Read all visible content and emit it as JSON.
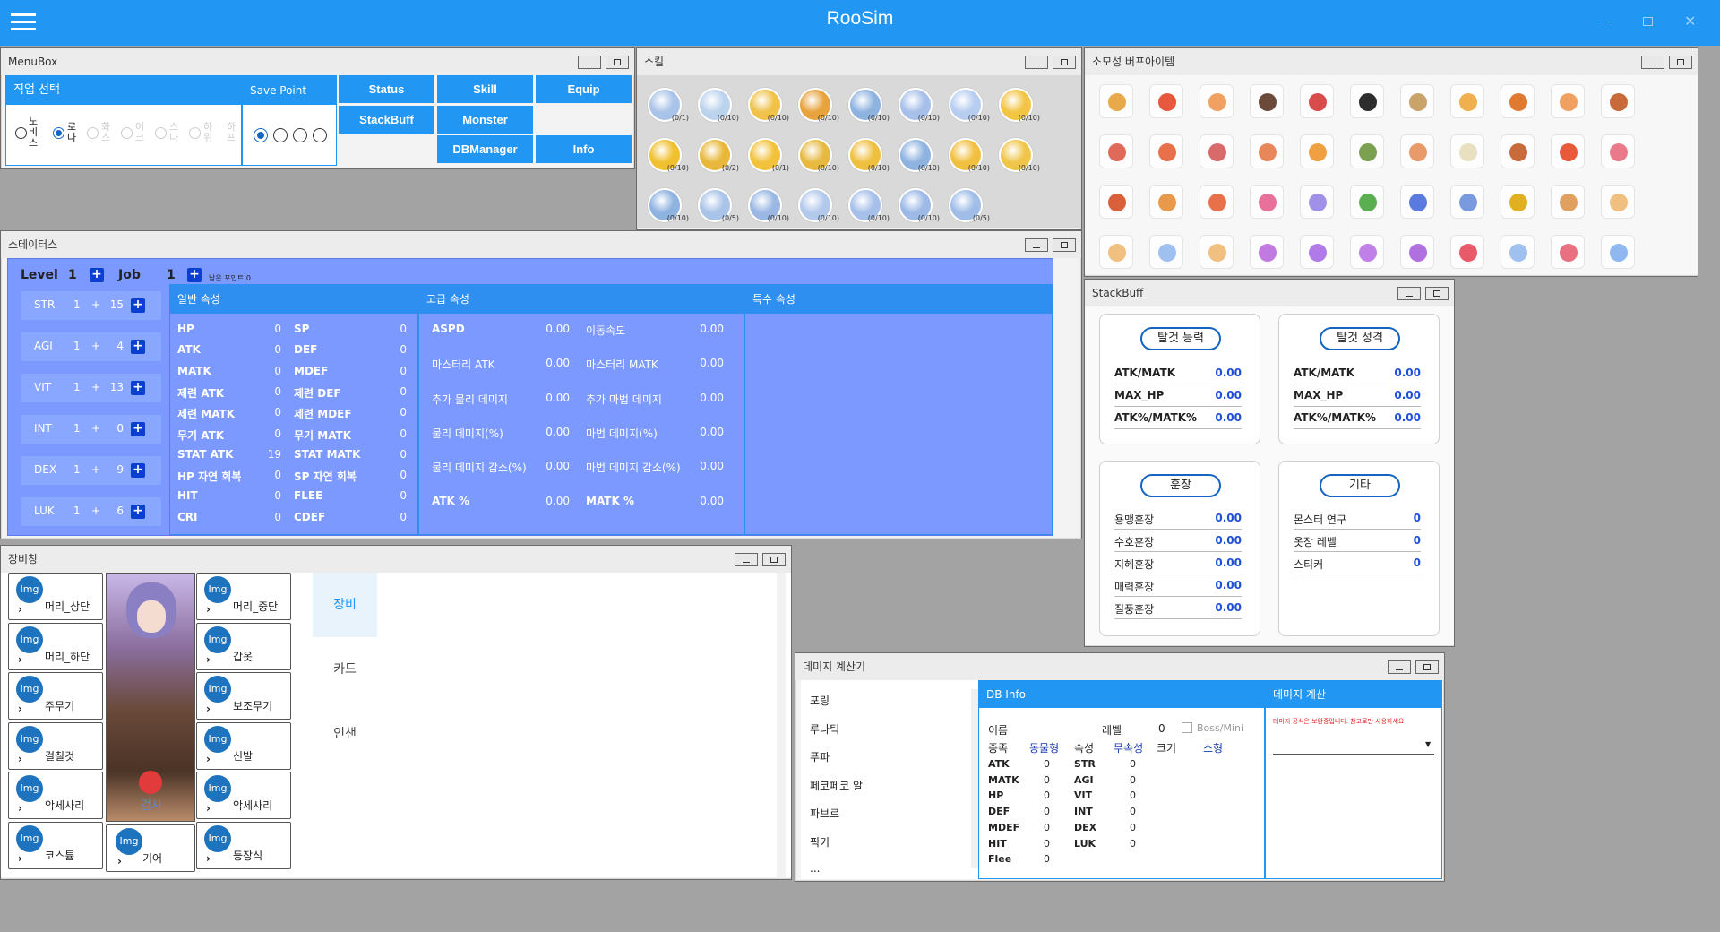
{
  "app": {
    "title": "RooSim"
  },
  "menubox": {
    "title": "MenuBox",
    "job_select": "직업 선택",
    "save_point": "Save Point",
    "jobs": [
      "노비스",
      "로나",
      "화스",
      "어크",
      "스나",
      "하위",
      "하프"
    ],
    "buttons": [
      "Status",
      "Skill",
      "Equip",
      "StackBuff",
      "Monster",
      "DBManager",
      "Info"
    ]
  },
  "skill": {
    "title": "스킬",
    "counts": [
      "(0/1)",
      "(0/10)",
      "(0/10)",
      "(0/10)",
      "(0/10)",
      "(0/10)",
      "(0/10)",
      "(0/10)",
      "(0/10)",
      "(0/2)",
      "(0/1)",
      "(0/10)",
      "(0/10)",
      "(0/10)",
      "(0/10)",
      "(0/10)",
      "(0/10)",
      "(0/5)",
      "(0/10)",
      "(0/10)",
      "(0/10)",
      "(0/10)",
      "(0/5)"
    ]
  },
  "buffitems": {
    "title": "소모성 버프아이템"
  },
  "status": {
    "title": "스테이터스",
    "level_label": "Level",
    "level": "1",
    "job_label": "Job",
    "job": "1",
    "remain_label": "남은 포인트",
    "remain": "0",
    "stats": [
      {
        "name": "STR",
        "base": "1",
        "plus": "15"
      },
      {
        "name": "AGI",
        "base": "1",
        "plus": "4"
      },
      {
        "name": "VIT",
        "base": "1",
        "plus": "13"
      },
      {
        "name": "INT",
        "base": "1",
        "plus": "0"
      },
      {
        "name": "DEX",
        "base": "1",
        "plus": "9"
      },
      {
        "name": "LUK",
        "base": "1",
        "plus": "6"
      }
    ],
    "sec_general": "일반 속성",
    "sec_advanced": "고급 속성",
    "sec_special": "특수 속성",
    "general_left": [
      [
        "HP",
        "0"
      ],
      [
        "ATK",
        "0"
      ],
      [
        "MATK",
        "0"
      ],
      [
        "제련 ATK",
        "0"
      ],
      [
        "제련 MATK",
        "0"
      ],
      [
        "무기 ATK",
        "0"
      ],
      [
        "STAT ATK",
        "19"
      ],
      [
        "HP 자연 회복",
        "0"
      ],
      [
        "HIT",
        "0"
      ],
      [
        "CRI",
        "0"
      ]
    ],
    "general_right": [
      [
        "SP",
        "0"
      ],
      [
        "DEF",
        "0"
      ],
      [
        "MDEF",
        "0"
      ],
      [
        "제련 DEF",
        "0"
      ],
      [
        "제련 MDEF",
        "0"
      ],
      [
        "무기 MATK",
        "0"
      ],
      [
        "STAT MATK",
        "0"
      ],
      [
        "SP 자연 회복",
        "0"
      ],
      [
        "FLEE",
        "0"
      ],
      [
        "CDEF",
        "0"
      ]
    ],
    "adv_left": [
      [
        "ASPD",
        "0.00"
      ],
      [
        "마스터리 ATK",
        "0.00"
      ],
      [
        "추가 물리 데미지",
        "0.00"
      ],
      [
        "물리 데미지(%)",
        "0.00"
      ],
      [
        "물리 데미지 감소(%)",
        "0.00"
      ],
      [
        "ATK %",
        "0.00"
      ]
    ],
    "adv_right": [
      [
        "이동속도",
        "0.00"
      ],
      [
        "마스터리 MATK",
        "0.00"
      ],
      [
        "추가 마법 데미지",
        "0.00"
      ],
      [
        "마법 데미지(%)",
        "0.00"
      ],
      [
        "마법 데미지 감소(%)",
        "0.00"
      ],
      [
        "MATK %",
        "0.00"
      ]
    ]
  },
  "stackbuff": {
    "title": "StackBuff",
    "c1": {
      "title": "탈것 능력",
      "rows": [
        [
          "ATK/MATK",
          "0.00"
        ],
        [
          "MAX_HP",
          "0.00"
        ],
        [
          "ATK%/MATK%",
          "0.00"
        ]
      ]
    },
    "c2": {
      "title": "탈것 성격",
      "rows": [
        [
          "ATK/MATK",
          "0.00"
        ],
        [
          "MAX_HP",
          "0.00"
        ],
        [
          "ATK%/MATK%",
          "0.00"
        ]
      ]
    },
    "c3": {
      "title": "훈장",
      "rows": [
        [
          "용맹훈장",
          "0.00"
        ],
        [
          "수호훈장",
          "0.00"
        ],
        [
          "지혜훈장",
          "0.00"
        ],
        [
          "매력훈장",
          "0.00"
        ],
        [
          "질풍훈장",
          "0.00"
        ]
      ]
    },
    "c4": {
      "title": "기타",
      "rows": [
        [
          "몬스터 연구",
          "0"
        ],
        [
          "옷장 레벨",
          "0"
        ],
        [
          "스티커",
          "0"
        ]
      ]
    }
  },
  "equip": {
    "title": "장비창",
    "img": "Img",
    "left": [
      "머리_상단",
      "머리_하단",
      "주무기",
      "걸칠것",
      "악세사리",
      "코스튬"
    ],
    "right": [
      "머리_중단",
      "갑옷",
      "보조무기",
      "신발",
      "악세사리",
      "등장식"
    ],
    "mid": "기어",
    "check": "검사",
    "tabs": [
      "장비",
      "카드",
      "인챈"
    ]
  },
  "damage": {
    "title": "데미지 계산기",
    "monsters": [
      "포링",
      "루나틱",
      "푸파",
      "페코페코 알",
      "파브르",
      "픽키",
      "..."
    ],
    "dbinfo": "DB Info",
    "calc": "데미지 계산",
    "warning": "데미지 공식은 보완중입니다. 참고로만 사용하세요",
    "name_label": "이름",
    "level_label": "레벨",
    "level": "0",
    "bossmini": "Boss/Mini",
    "race_label": "종족",
    "race": "동물형",
    "elem_label": "속성",
    "elem": "무속성",
    "size_label": "크기",
    "size": "소형",
    "left": [
      [
        "ATK",
        "0"
      ],
      [
        "MATK",
        "0"
      ],
      [
        "HP",
        "0"
      ],
      [
        "DEF",
        "0"
      ],
      [
        "MDEF",
        "0"
      ],
      [
        "HIT",
        "0"
      ],
      [
        "Flee",
        "0"
      ]
    ],
    "right": [
      [
        "STR",
        "0"
      ],
      [
        "AGI",
        "0"
      ],
      [
        "VIT",
        "0"
      ],
      [
        "INT",
        "0"
      ],
      [
        "DEX",
        "0"
      ],
      [
        "LUK",
        "0"
      ]
    ]
  },
  "colors": {
    "accent": "#2196f3",
    "status_bg": "#7b99ff"
  }
}
